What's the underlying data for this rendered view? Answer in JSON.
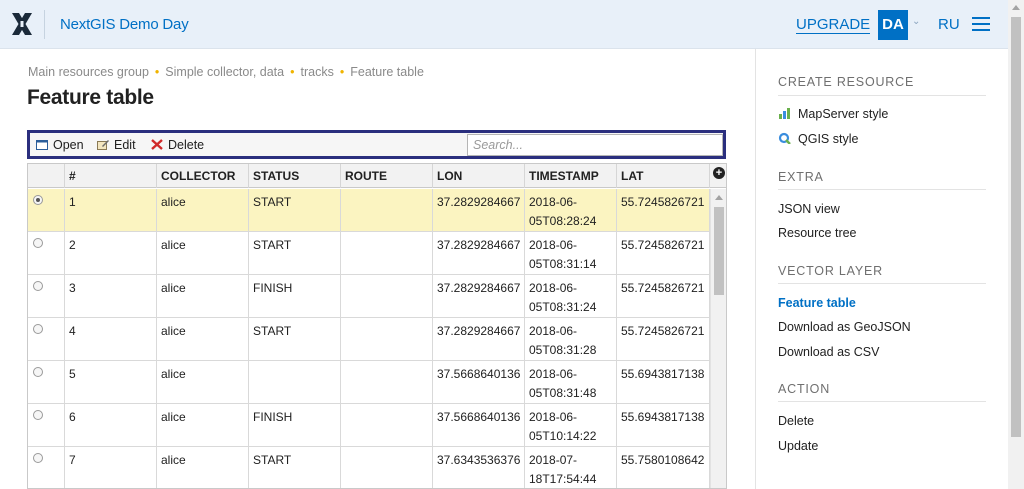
{
  "header": {
    "app_title": "NextGIS Demo Day",
    "upgrade_label": "UPGRADE",
    "avatar_initials": "DA",
    "language": "RU"
  },
  "breadcrumb": [
    "Main resources group",
    "Simple collector, data",
    "tracks",
    "Feature table"
  ],
  "page_title": "Feature table",
  "toolbar": {
    "open_label": "Open",
    "edit_label": "Edit",
    "delete_label": "Delete",
    "search_placeholder": "Search..."
  },
  "table": {
    "columns": [
      "#",
      "COLLECTOR",
      "STATUS",
      "ROUTE",
      "LON",
      "TIMESTAMP",
      "LAT"
    ],
    "rows": [
      {
        "selected": true,
        "id": "1",
        "collector": "alice",
        "status": "START",
        "route": "",
        "lon": "37.2829284667",
        "ts1": "2018-06-",
        "ts2": "05T08:28:24",
        "lat": "55.7245826721"
      },
      {
        "selected": false,
        "id": "2",
        "collector": "alice",
        "status": "START",
        "route": "",
        "lon": "37.2829284667",
        "ts1": "2018-06-",
        "ts2": "05T08:31:14",
        "lat": "55.7245826721"
      },
      {
        "selected": false,
        "id": "3",
        "collector": "alice",
        "status": "FINISH",
        "route": "",
        "lon": "37.2829284667",
        "ts1": "2018-06-",
        "ts2": "05T08:31:24",
        "lat": "55.7245826721"
      },
      {
        "selected": false,
        "id": "4",
        "collector": "alice",
        "status": "START",
        "route": "",
        "lon": "37.2829284667",
        "ts1": "2018-06-",
        "ts2": "05T08:31:28",
        "lat": "55.7245826721"
      },
      {
        "selected": false,
        "id": "5",
        "collector": "alice",
        "status": "",
        "route": "",
        "lon": "37.5668640136",
        "ts1": "2018-06-",
        "ts2": "05T08:31:48",
        "lat": "55.6943817138"
      },
      {
        "selected": false,
        "id": "6",
        "collector": "alice",
        "status": "FINISH",
        "route": "",
        "lon": "37.5668640136",
        "ts1": "2018-06-",
        "ts2": "05T10:14:22",
        "lat": "55.6943817138"
      },
      {
        "selected": false,
        "id": "7",
        "collector": "alice",
        "status": "START",
        "route": "",
        "lon": "37.6343536376",
        "ts1": "2018-07-",
        "ts2": "18T17:54:44",
        "lat": "55.7580108642"
      }
    ]
  },
  "sidebar": {
    "create_resource": {
      "title": "CREATE RESOURCE",
      "items": [
        {
          "label": "MapServer style",
          "icon": "mapserver-style-icon"
        },
        {
          "label": "QGIS style",
          "icon": "qgis-style-icon"
        }
      ]
    },
    "extra": {
      "title": "EXTRA",
      "items": [
        "JSON view",
        "Resource tree"
      ]
    },
    "vector_layer": {
      "title": "VECTOR LAYER",
      "items": [
        "Feature table",
        "Download as GeoJSON",
        "Download as CSV"
      ]
    },
    "action": {
      "title": "ACTION",
      "items": [
        "Delete",
        "Update"
      ]
    }
  },
  "colors": {
    "accent": "#0070c5",
    "header_bg": "#e8f0f9",
    "selected_row": "#fbf4c1",
    "breadcrumb_dot": "#f0b400",
    "toolbar_border": "#2b2f7e"
  }
}
